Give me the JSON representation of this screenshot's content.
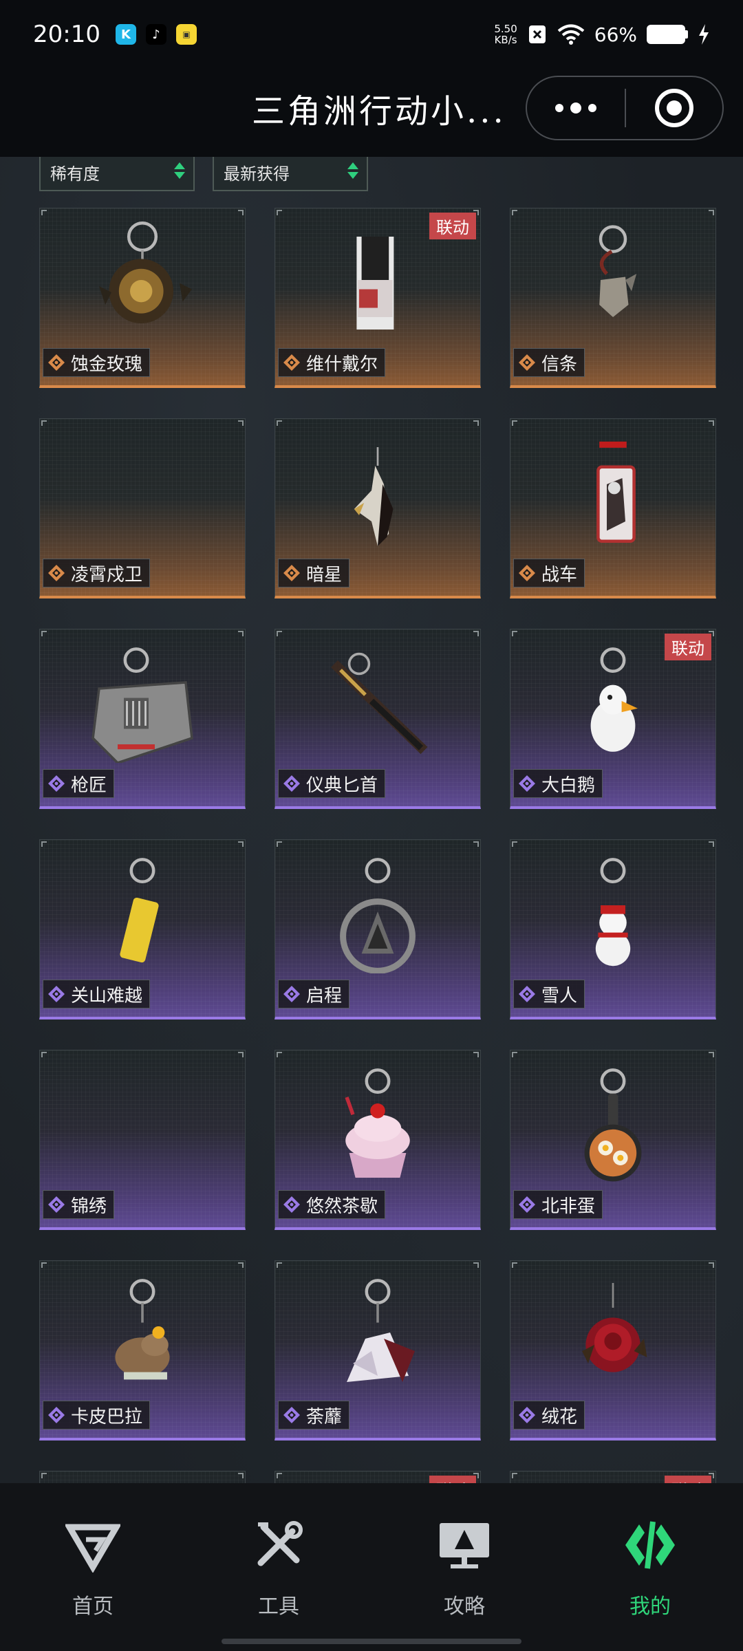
{
  "status_bar": {
    "time": "20:10",
    "net_speed_value": "5.50",
    "net_speed_unit": "KB/s",
    "battery": "66%"
  },
  "header": {
    "title": "三角洲行动小..."
  },
  "filters": {
    "rarity": "稀有度",
    "sort": "最新获得"
  },
  "items": [
    {
      "name": "蚀金玫瑰",
      "rarity": "gold",
      "collab": false,
      "art": "rose-keychain"
    },
    {
      "name": "维什戴尔",
      "rarity": "gold",
      "collab": true,
      "art": "card-keychain"
    },
    {
      "name": "信条",
      "rarity": "gold",
      "collab": false,
      "art": "hook-keychain"
    },
    {
      "name": "凌霄戍卫",
      "rarity": "gold",
      "collab": false,
      "art": "none"
    },
    {
      "name": "暗星",
      "rarity": "gold",
      "collab": false,
      "art": "mask-keychain"
    },
    {
      "name": "战车",
      "rarity": "gold",
      "collab": false,
      "art": "tarot-keychain"
    },
    {
      "name": "枪匠",
      "rarity": "purple",
      "collab": false,
      "art": "case-keychain"
    },
    {
      "name": "仪典匕首",
      "rarity": "purple",
      "collab": false,
      "art": "dagger-keychain"
    },
    {
      "name": "大白鹅",
      "rarity": "purple",
      "collab": true,
      "art": "goose-keychain"
    },
    {
      "name": "关山难越",
      "rarity": "purple",
      "collab": false,
      "art": "can-keychain"
    },
    {
      "name": "启程",
      "rarity": "purple",
      "collab": false,
      "art": "medal-keychain"
    },
    {
      "name": "雪人",
      "rarity": "purple",
      "collab": false,
      "art": "snowman-keychain"
    },
    {
      "name": "锦绣",
      "rarity": "purple",
      "collab": false,
      "art": "none"
    },
    {
      "name": "悠然茶歇",
      "rarity": "purple",
      "collab": false,
      "art": "cupcake-keychain"
    },
    {
      "name": "北非蛋",
      "rarity": "purple",
      "collab": false,
      "art": "pan-keychain"
    },
    {
      "name": "卡皮巴拉",
      "rarity": "purple",
      "collab": false,
      "art": "capybara-keychain"
    },
    {
      "name": "荼蘼",
      "rarity": "purple",
      "collab": false,
      "art": "flower-keychain"
    },
    {
      "name": "绒花",
      "rarity": "purple",
      "collab": false,
      "art": "red-rose-keychain"
    },
    {
      "name": "",
      "rarity": "purple",
      "collab": false,
      "art": "none"
    },
    {
      "name": "",
      "rarity": "purple",
      "collab": true,
      "art": "none"
    },
    {
      "name": "",
      "rarity": "purple",
      "collab": true,
      "art": "none"
    }
  ],
  "collab_label": "联动",
  "nav": [
    {
      "label": "首页",
      "icon": "home-logo-icon"
    },
    {
      "label": "工具",
      "icon": "tools-icon"
    },
    {
      "label": "攻略",
      "icon": "guide-monitor-icon"
    },
    {
      "label": "我的",
      "icon": "profile-logo-icon",
      "active": true
    }
  ],
  "colors": {
    "accent": "#2fd67a",
    "gold_rarity": "#d98a4a",
    "purple_rarity": "#9a7ae6",
    "collab_badge": "#c5474a"
  }
}
